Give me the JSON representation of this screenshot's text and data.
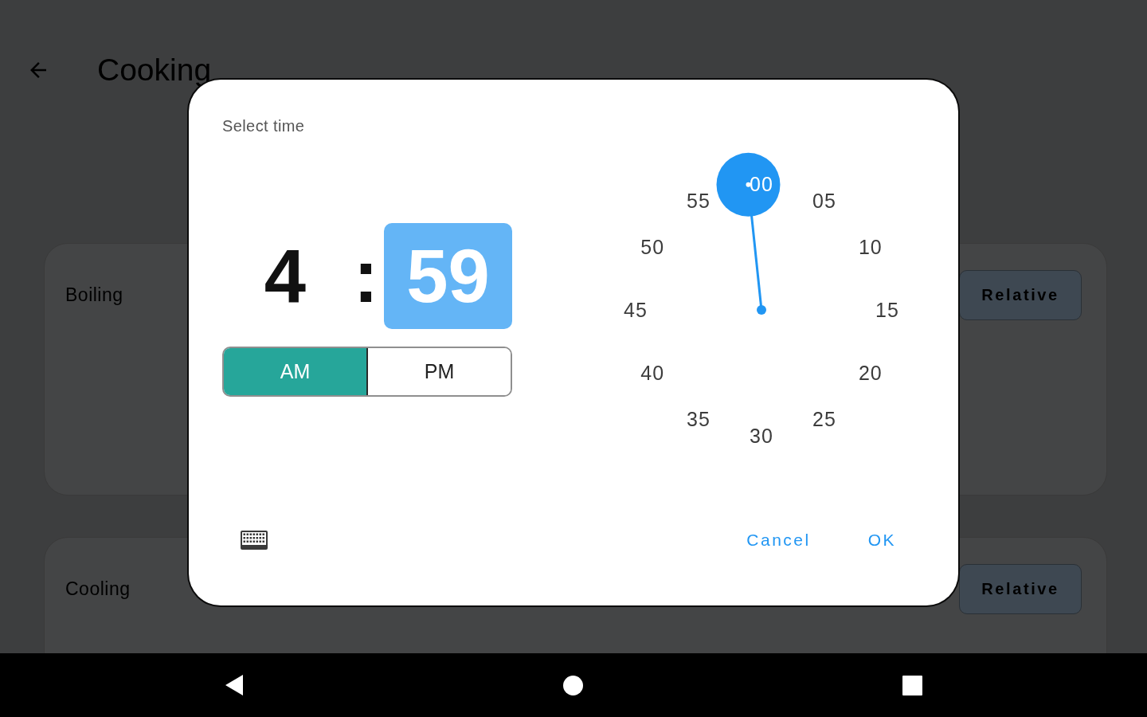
{
  "app_bar": {
    "title": "Cooking"
  },
  "list": [
    {
      "label": "Boiling",
      "button": "Relative"
    },
    {
      "label": "Cooling",
      "button": "Relative"
    }
  ],
  "dialog": {
    "title": "Select time",
    "fields": [
      {
        "value": "4",
        "selected": false
      },
      {
        "value": "59",
        "selected": true
      }
    ],
    "separator": ":",
    "periods": [
      {
        "label": "AM",
        "selected": true
      },
      {
        "label": "PM",
        "selected": false
      }
    ],
    "dial": {
      "labels": [
        "00",
        "05",
        "10",
        "15",
        "20",
        "25",
        "30",
        "35",
        "40",
        "45",
        "50",
        "55"
      ]
    },
    "actions": [
      "Cancel",
      "OK"
    ]
  }
}
